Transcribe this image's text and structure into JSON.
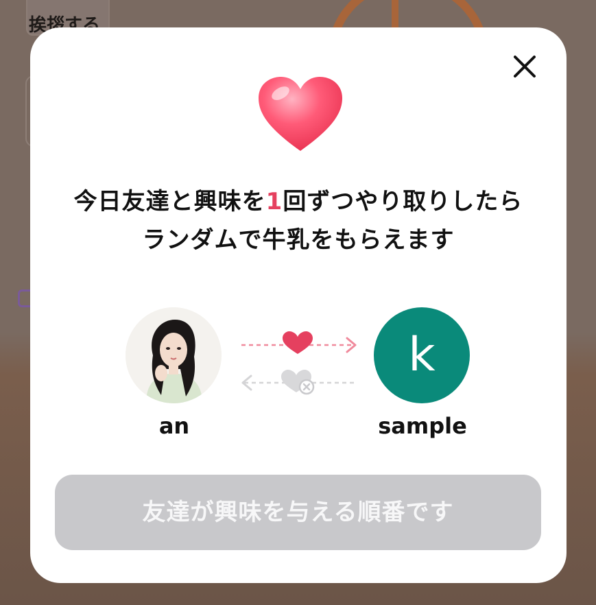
{
  "background": {
    "greet_label": "挨拶する"
  },
  "modal": {
    "headline_part1": "今日友達と興味を",
    "headline_count": "1",
    "headline_part2": "回ずつやり取りしたら",
    "headline_line2": "ランダムで牛乳をもらえます",
    "user_left": {
      "name": "an"
    },
    "user_right": {
      "name": "sample",
      "initial": "k",
      "avatar_color": "#0a8a7a"
    },
    "cta_label": "友達が興味を与える順番です",
    "cta_color": "#c8c8cb",
    "accent_color": "#e5405f"
  }
}
